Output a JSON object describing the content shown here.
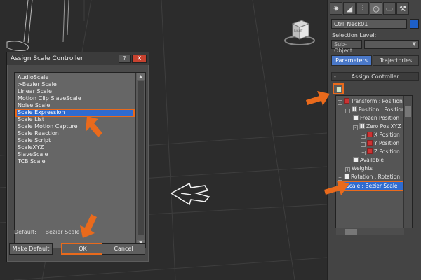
{
  "dialog": {
    "title": "Assign Scale Controller",
    "help_label": "?",
    "close_label": "X",
    "items": [
      "AudioScale",
      ">Bezier Scale",
      "Linear Scale",
      "Motion Clip SlaveScale",
      "Noise Scale",
      "Scale Expression",
      "Scale List",
      "Scale Motion Capture",
      "Scale Reaction",
      "Scale Script",
      "ScaleXYZ",
      "SlaveScale",
      "TCB Scale"
    ],
    "selected_index": 5,
    "default_label": "Default:",
    "default_value": "Bezier Scale",
    "buttons": {
      "make_default": "Make Default",
      "ok": "OK",
      "cancel": "Cancel"
    }
  },
  "panel": {
    "object_name": "Ctrl_Neck01",
    "object_color": "#1e5fc7",
    "selection_level_label": "Selection Level:",
    "sub_object_label": "Sub-Object",
    "tabs": {
      "parameters": "Parameters",
      "trajectories": "Trajectories"
    },
    "rollout_title": "Assign Controller",
    "rollout_toggle": "-",
    "tree": [
      {
        "label": "Transform : Position",
        "depth": 0,
        "expander": "-",
        "icon": "red"
      },
      {
        "label": "Position : Position",
        "depth": 1,
        "expander": "-",
        "icon": "grid"
      },
      {
        "label": "Frozen Position",
        "depth": 2,
        "expander": "",
        "icon": "grid"
      },
      {
        "label": "Zero Pos XYZ",
        "depth": 2,
        "expander": "-",
        "icon": "grid"
      },
      {
        "label": "X Position",
        "depth": 3,
        "expander": "+",
        "icon": "red"
      },
      {
        "label": "Y Position",
        "depth": 3,
        "expander": "+",
        "icon": "red"
      },
      {
        "label": "Z Position",
        "depth": 3,
        "expander": "+",
        "icon": "red"
      },
      {
        "label": "Available",
        "depth": 2,
        "expander": "",
        "icon": "grid"
      },
      {
        "label": "Weights",
        "depth": 1,
        "expander": "+",
        "icon": ""
      },
      {
        "label": "Rotation : Rotation",
        "depth": 0,
        "expander": "+",
        "icon": "grid"
      },
      {
        "label": "Scale : Bezier Scale",
        "depth": 0,
        "expander": "",
        "icon": "grid"
      }
    ],
    "selected_tree_index": 10
  },
  "viewport": {
    "viewcube_label": "RIGHT"
  },
  "colors": {
    "highlight": "#e96a1c",
    "selection": "#2f6bd0",
    "background": "#2b2b2b"
  }
}
